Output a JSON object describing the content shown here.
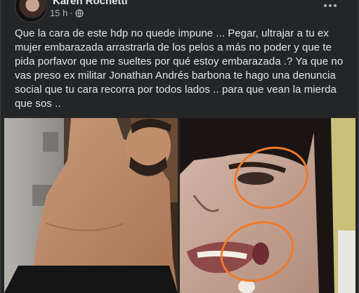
{
  "post": {
    "author": "Karen Rochetti",
    "timestamp": "15 h",
    "audience_icon": "globe-icon",
    "more_icon": "more-options-icon",
    "text": "Que la cara de este hdp no quede impune ... Pegar, ultrajar a tu ex mujer embarazada arrastrarla de los pelos a más no poder y que te pida porfavor que me sueltes por qué estoy embarazada .? Ya que no vas preso ex militar Jonathan Andrés barbona te hago una denuncia social que tu cara recorra por todos lados .. para que vean la mierda que sos ..",
    "photos": [
      {
        "name": "photo-shirtless-man"
      },
      {
        "name": "photo-injured-woman-face"
      }
    ]
  },
  "colors": {
    "post_background": "#242526",
    "text_primary": "#e4e6eb",
    "text_secondary": "#b0b3b8",
    "annotation_circle": "#f07a2a"
  }
}
